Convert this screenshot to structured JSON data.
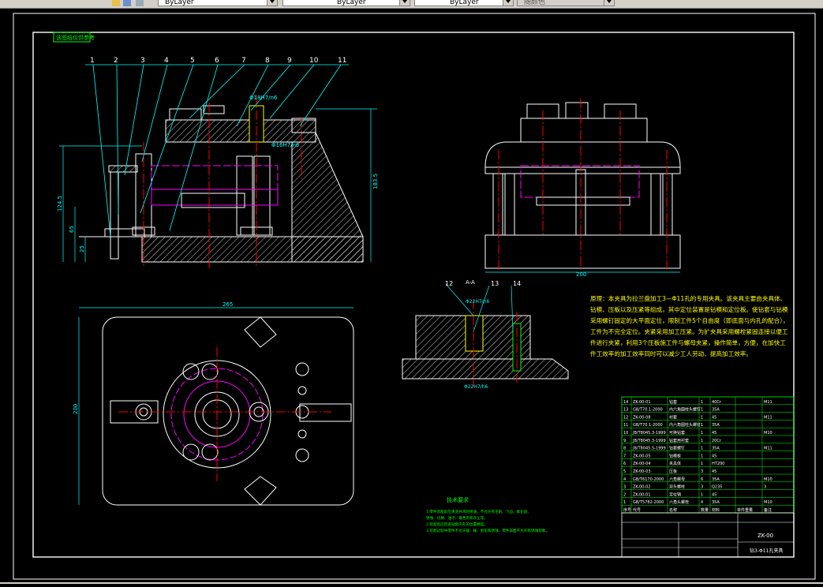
{
  "toolbar": {
    "layer_combos": [
      "ByLayer",
      "ByLayer",
      "ByLayer"
    ],
    "plot_style": "随颜色"
  },
  "drawing": {
    "stamp_label": "该图纸仅供参考",
    "callouts": [
      "1",
      "2",
      "3",
      "4",
      "5",
      "6",
      "7",
      "8",
      "9",
      "10",
      "11",
      "12",
      "13",
      "14"
    ],
    "dimensions": {
      "front_fit_top": "Φ18H7/n6",
      "front_fit_mid": "Φ16H7/n6",
      "height_overall": "183.5",
      "height_1": "124.5",
      "height_2": "65",
      "height_3": "25",
      "side_width": "200",
      "top_width": "265",
      "top_height": "200",
      "section_label": "A-A",
      "section_fit": "Φ22H7/n6",
      "section_bottom_fit": "Φ22H7/h6"
    },
    "principle_text": "原理：本夹具为拉兰盘加工3—Φ11孔的专用夹具。该夹具主要由夹具体、钻模、压板以及压紧等组成，其中定位装置是钻模和定位板。使钻套与钻模采用螺钉固定的大平面定位，限制工件5个自由度（即底面与内孔的配合），工件为不完全定位。夹紧采用加工压紧。为扩夹具采用螺栓紧固连接以便工件进行夹紧，利用3个压板施工件与螺母夹紧，操作简单，方便，在加快工件工效率的加工效率同时可以减少工人劳动、提高加工效率。",
    "tech_req_title": "技术要求",
    "tech_req_lines": [
      "1.零件装配前应清洗并涂防锈油，不允许有毛刺、飞边、氧化皮、",
      "锈蚀、切屑、油污、着色剂和灰尘等。",
      "2.装配后应检查钻套内孔的位置精度。",
      "3.装配过程中零件不允许磕、碰、划伤和锈蚀，零件表面不允许有锈蚀现象。"
    ],
    "bom_rows": [
      [
        "14",
        "ZK-00-01",
        "钻套",
        "1",
        "40Cr",
        "",
        "M11"
      ],
      [
        "13",
        "GB/T70.1-2000",
        "内六角圆柱头螺钉",
        "1",
        "35A",
        "",
        ""
      ],
      [
        "12",
        "ZK-00-08",
        "衬套",
        "1",
        "45",
        "",
        "M11"
      ],
      [
        "11",
        "GB/T70.1-2000",
        "内六角圆柱头螺钉",
        "1",
        "35A",
        "",
        ""
      ],
      [
        "10",
        "JB/T8045.3-1999",
        "可换钻套",
        "1",
        "45",
        "",
        "M10"
      ],
      [
        "9",
        "JB/T8045.3-1999",
        "钻套用衬套",
        "1",
        "20Cr",
        "",
        ""
      ],
      [
        "8",
        "JB/T8045.5-1999",
        "钻套螺钉",
        "1",
        "35A",
        "",
        "M11"
      ],
      [
        "7",
        "ZK-00-05",
        "钻模板",
        "1",
        "45",
        "",
        ""
      ],
      [
        "6",
        "ZK-00-04",
        "夹具体",
        "1",
        "HT200",
        "",
        ""
      ],
      [
        "5",
        "ZK-00-03",
        "压板",
        "3",
        "45",
        "",
        ""
      ],
      [
        "4",
        "GB/T6170-2000",
        "六角螺母",
        "6",
        "35A",
        "",
        "M10"
      ],
      [
        "3",
        "ZK-00-02",
        "双头螺柱",
        "3",
        "Q235",
        "",
        "3"
      ],
      [
        "2",
        "ZK-00-01",
        "定位销",
        "1",
        "45",
        "",
        ""
      ],
      [
        "1",
        "GB/T5782-2000",
        "六角头螺栓",
        "4",
        "35A",
        "",
        "M10"
      ]
    ],
    "bom_header": [
      "序号",
      "代号",
      "名称",
      "数量",
      "材料",
      "单件重量",
      "备注"
    ],
    "title_block": {
      "drawing_no": "ZK-00",
      "name": "钻3-Φ11孔夹具"
    }
  }
}
